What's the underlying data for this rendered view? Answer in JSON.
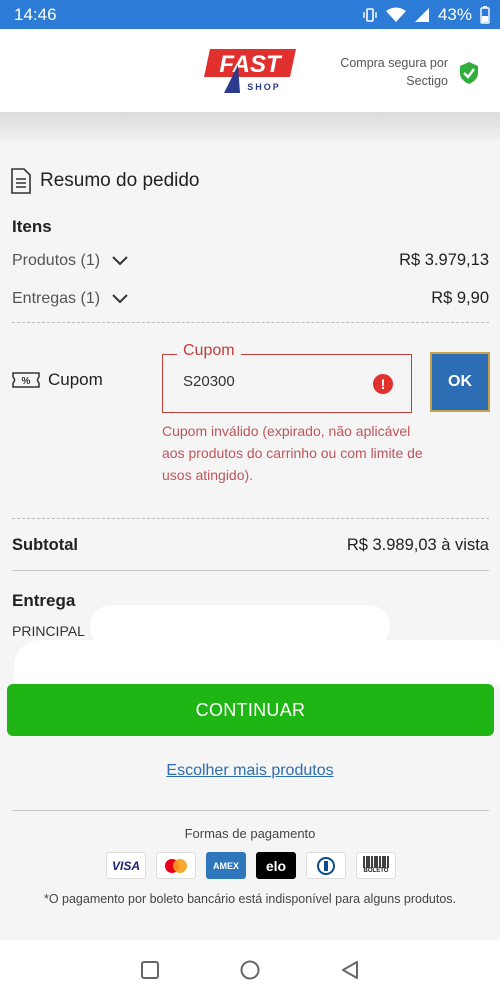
{
  "status_bar": {
    "time": "14:46",
    "battery": "43%"
  },
  "header": {
    "logo_text": "FAST",
    "logo_sub": "SHOP",
    "secure_line1": "Compra segura por",
    "secure_line2": "Sectigo"
  },
  "summary": {
    "title": "Resumo do pedido",
    "items_heading": "Itens",
    "rows": [
      {
        "label": "Produtos (1)",
        "value": "R$ 3.979,13"
      },
      {
        "label": "Entregas (1)",
        "value": "R$ 9,90"
      }
    ]
  },
  "coupon": {
    "label": "Cupom",
    "field_legend": "Cupom",
    "value": "S20300",
    "ok_label": "OK",
    "error": "Cupom inválido (expirado, não aplicável aos produtos do carrinho ou com limite de usos atingido)."
  },
  "subtotal": {
    "label": "Subtotal",
    "value": "R$ 3.989,03 à vista"
  },
  "delivery": {
    "label": "Entrega",
    "address_prefix": "PRINCIPAL"
  },
  "actions": {
    "continue": "CONTINUAR",
    "more_products": "Escolher mais produtos"
  },
  "payment": {
    "title": "Formas de pagamento",
    "methods": [
      "VISA",
      "Mastercard",
      "AMEX",
      "elo",
      "Diners",
      "BOLETO"
    ],
    "note": "*O pagamento por boleto bancário está indisponível para alguns produtos."
  },
  "colors": {
    "status_bar": "#2c7bd6",
    "brand_red": "#e0312f",
    "ok_button": "#2d6db3",
    "continue_button": "#1fb515",
    "error": "#c43d3d"
  }
}
